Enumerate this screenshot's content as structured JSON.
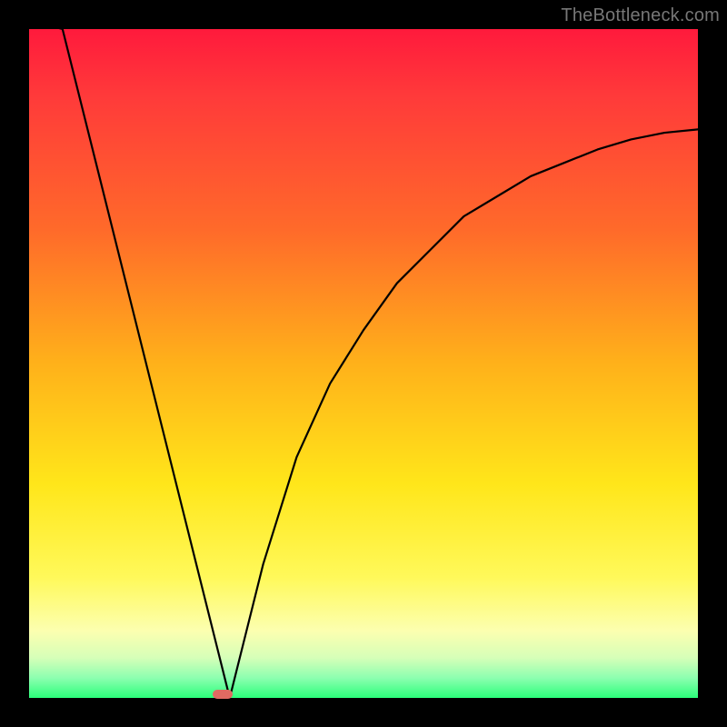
{
  "watermark": "TheBottleneck.com",
  "marker": {
    "color": "#e06a62"
  },
  "chart_data": {
    "type": "line",
    "title": "",
    "xlabel": "",
    "ylabel": "",
    "xlim": [
      0,
      100
    ],
    "ylim": [
      0,
      100
    ],
    "grid": false,
    "series": [
      {
        "name": "bottleneck-curve",
        "x": [
          0,
          5,
          10,
          15,
          20,
          23,
          25,
          27,
          28,
          29,
          30,
          32,
          35,
          40,
          45,
          50,
          55,
          60,
          65,
          70,
          75,
          80,
          85,
          90,
          95,
          100
        ],
        "values": [
          120,
          100,
          80,
          60,
          40,
          28,
          20,
          12,
          8,
          4,
          0,
          8,
          20,
          36,
          47,
          55,
          62,
          67,
          72,
          75,
          78,
          80,
          82,
          83.5,
          84.5,
          85
        ]
      }
    ],
    "annotations": [
      {
        "name": "optimal-marker",
        "x": 29,
        "y": 0
      }
    ],
    "background": {
      "type": "vertical-gradient",
      "stops_top_to_bottom": [
        "#ff1a3c",
        "#ffe61a",
        "#2bff7a"
      ]
    }
  }
}
